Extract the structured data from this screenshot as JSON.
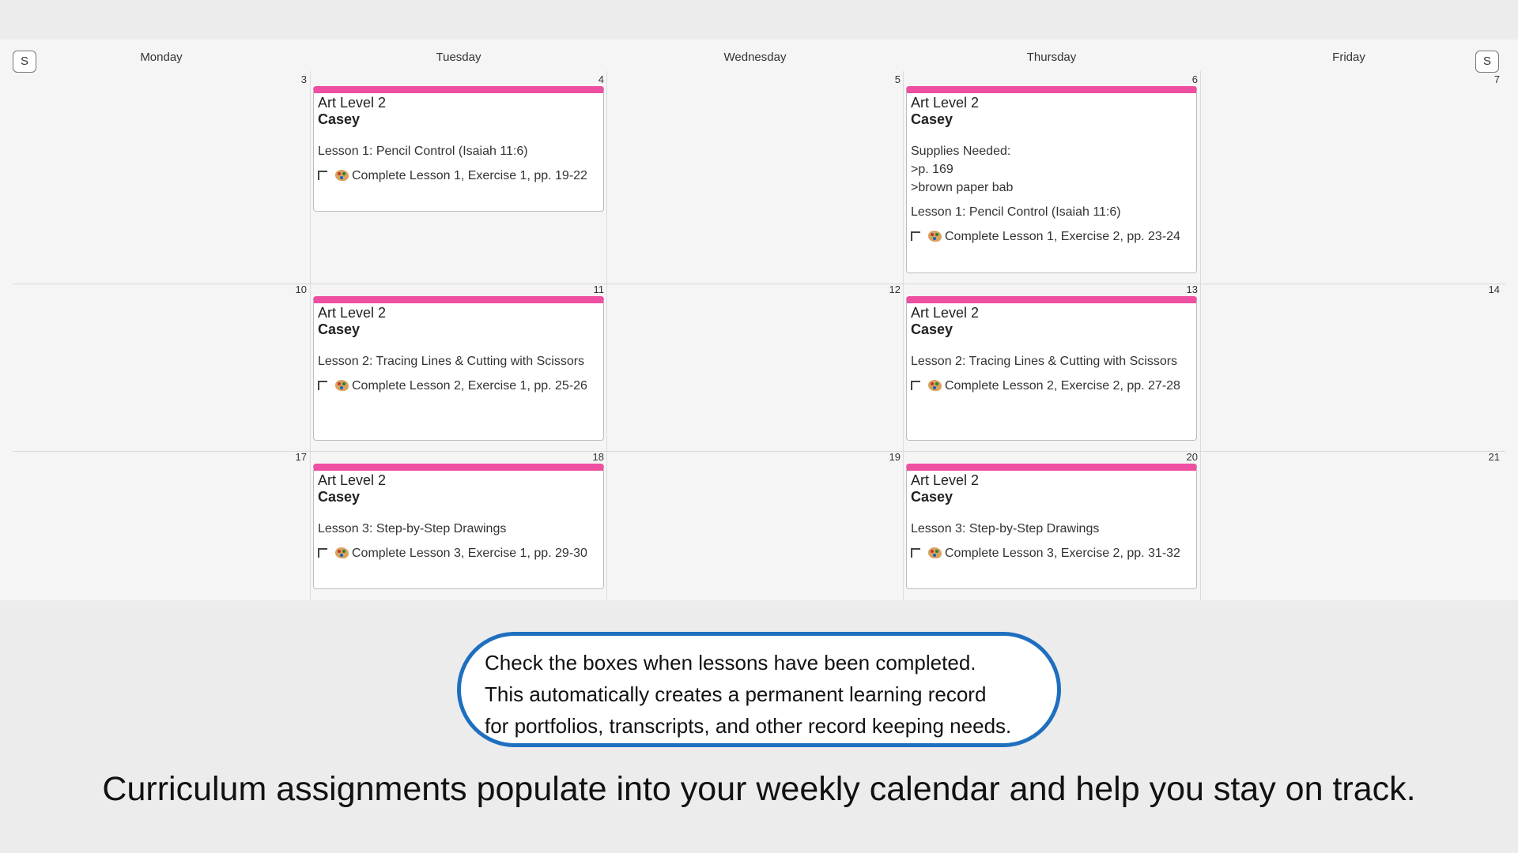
{
  "calendar": {
    "nav_prev": "S",
    "nav_next": "S",
    "days": [
      "Monday",
      "Tuesday",
      "Wednesday",
      "Thursday",
      "Friday"
    ],
    "weeks": [
      {
        "dates": [
          "3",
          "4",
          "5",
          "6",
          "7"
        ]
      },
      {
        "dates": [
          "10",
          "11",
          "12",
          "13",
          "14"
        ]
      },
      {
        "dates": [
          "17",
          "18",
          "19",
          "20",
          "21"
        ]
      }
    ]
  },
  "cards": [
    {
      "subject": "Art Level 2",
      "student": "Casey",
      "lesson": "Lesson 1: Pencil Control (Isaiah 11:6)",
      "task": "Complete Lesson 1, Exercise 1, pp. 19-22"
    },
    {
      "subject": "Art Level 2",
      "student": "Casey",
      "supplies": [
        "Supplies Needed:",
        ">p. 169",
        ">brown paper bab"
      ],
      "lesson": "Lesson 1: Pencil Control (Isaiah 11:6)",
      "task": "Complete Lesson 1, Exercise 2, pp. 23-24"
    },
    {
      "subject": "Art Level 2",
      "student": "Casey",
      "lesson": "Lesson 2: Tracing Lines & Cutting with Scissors",
      "task": "Complete Lesson 2, Exercise 1, pp. 25-26"
    },
    {
      "subject": "Art Level 2",
      "student": "Casey",
      "lesson": "Lesson 2: Tracing Lines & Cutting with Scissors",
      "task": "Complete Lesson 2, Exercise 2, pp. 27-28"
    },
    {
      "subject": "Art Level 2",
      "student": "Casey",
      "lesson": "Lesson 3: Step-by-Step Drawings",
      "task": "Complete Lesson 3, Exercise 1, pp. 29-30"
    },
    {
      "subject": "Art Level 2",
      "student": "Casey",
      "lesson": "Lesson 3: Step-by-Step Drawings",
      "task": "Complete Lesson 3, Exercise 2, pp. 31-32"
    }
  ],
  "callout": {
    "lines": [
      "Check the boxes when lessons have been completed.",
      "This automatically creates a permanent learning record",
      "for portfolios, transcripts, and other record keeping needs."
    ]
  },
  "tagline": "Curriculum assignments populate into your weekly calendar and help you stay on track.",
  "colors": {
    "card_accent": "#ee4fa1",
    "callout_border": "#1f6fbf"
  }
}
